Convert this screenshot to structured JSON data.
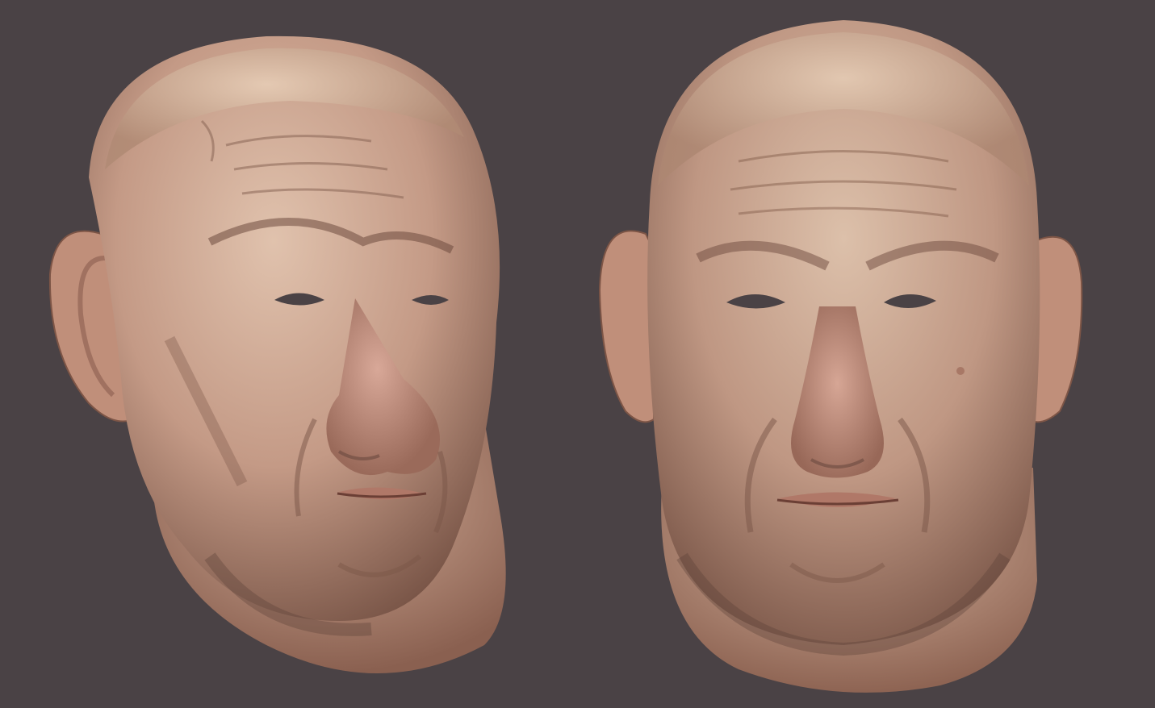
{
  "scene": {
    "background_color": "#4a4245",
    "skin_color": "#c49a86",
    "shadow_color": "#6b4a40",
    "highlight_color": "#e3c8b3",
    "renders": [
      {
        "view": "three-quarter",
        "icon": "head-sculpt-three-quarter"
      },
      {
        "view": "front",
        "icon": "head-sculpt-front"
      }
    ]
  }
}
